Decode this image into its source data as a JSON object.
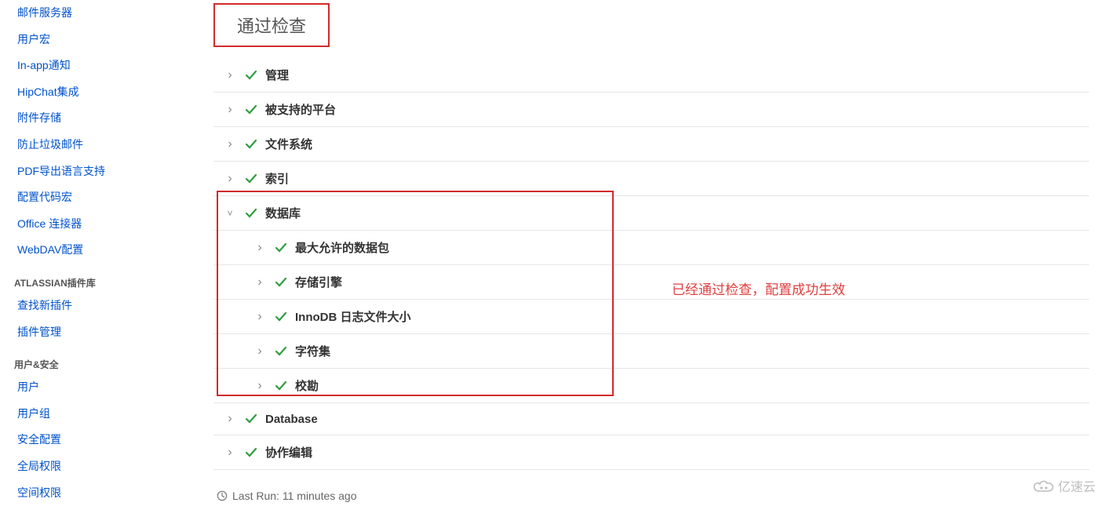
{
  "title": "通过检查",
  "annotation": "已经通过检查，配置成功生效",
  "sidebar": {
    "items_top": [
      "邮件服务器",
      "用户宏",
      "In-app通知",
      "HipChat集成",
      "附件存储",
      "防止垃圾邮件",
      "PDF导出语言支持",
      "配置代码宏",
      "Office 连接器",
      "WebDAV配置"
    ],
    "header_plugins": "ATLASSIAN插件库",
    "items_plugins": [
      "查找新插件",
      "插件管理"
    ],
    "header_security": "用户&安全",
    "items_security": [
      "用户",
      "用户组",
      "安全配置",
      "全局权限",
      "空间权限"
    ]
  },
  "checks": {
    "main": [
      "管理",
      "被支持的平台",
      "文件系统",
      "索引",
      "数据库"
    ],
    "db_children": [
      "最大允许的数据包",
      "存储引擎",
      "InnoDB 日志文件大小",
      "字符集",
      "校勘"
    ],
    "after": [
      "Database",
      "协作编辑"
    ]
  },
  "footer": "Last Run: 11 minutes ago",
  "watermark": "亿速云"
}
